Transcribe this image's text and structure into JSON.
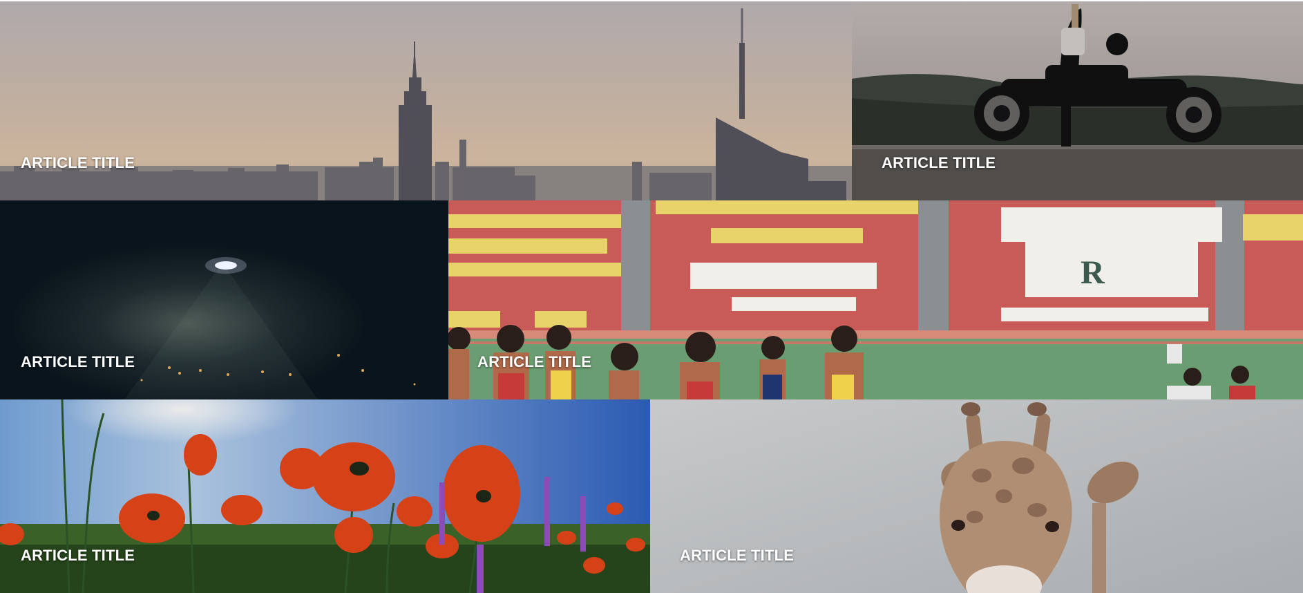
{
  "articles": [
    {
      "title": "ARTICLE TITLE",
      "image": "city-skyline-image"
    },
    {
      "title": "ARTICLE TITLE",
      "image": "motorcycle-rider-image"
    },
    {
      "title": "ARTICLE TITLE",
      "image": "night-floodlight-image"
    },
    {
      "title": "ARTICLE TITLE",
      "image": "stadium-runners-image"
    },
    {
      "title": "ARTICLE TITLE",
      "image": "poppy-field-image"
    },
    {
      "title": "ARTICLE TITLE",
      "image": "giraffe-image"
    }
  ]
}
